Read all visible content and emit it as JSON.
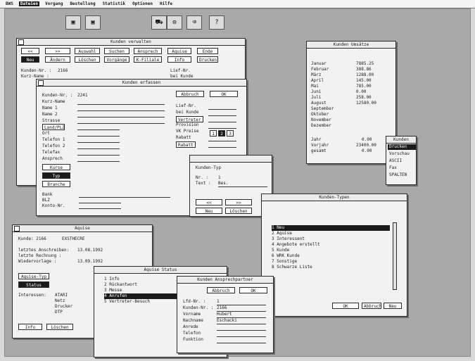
{
  "menubar": {
    "items": [
      "BWS",
      "Dateien",
      "Vorgang",
      "Bestellung",
      "Statistik",
      "Optionen",
      "Hilfe"
    ]
  },
  "win_verwalten": {
    "title": "Kunden verwalten",
    "buttons": [
      "<<",
      ">>",
      "Auswahl",
      "Suchen",
      "Ansprech",
      "Aquise",
      "Ende",
      "Neu",
      "Ändern",
      "Löschen",
      "Vorgänge",
      "K-Filiale",
      "Info",
      "Drucken"
    ],
    "kundennr_label": "Kunden-Nr. :",
    "kundennr_value": "2166",
    "kurzname_label": "Kurz-Name :",
    "liefnr_label": "Lief-Nr.",
    "ansprech_label": "bei Kunde"
  },
  "win_erfassen": {
    "title": "Kunden erfassen",
    "abbruch": "Abbruch",
    "ok": "OK",
    "fields": [
      "Kunden-Nr. :",
      "Kurz-Name",
      "Name 1",
      "Name 2",
      "Strasse",
      "Land/PLZ",
      "Ort",
      "Telefon 1",
      "Telefon 2",
      "Telefax",
      "Ansprech"
    ],
    "kundennr_value": "2241",
    "right_labels": [
      "Lief-Nr.",
      "bei Kunde",
      "Vertreter",
      "Provision",
      "VK Preise",
      "Rabatt",
      "Rabatt"
    ],
    "preise": [
      "1",
      "2",
      "3"
    ],
    "buttons": [
      "Kurse",
      "Typ",
      "Branche"
    ],
    "bottom": [
      "Bank",
      "BLZ",
      "Konto-Nr."
    ]
  },
  "win_umsatz": {
    "title": "Kunden Umsätze",
    "months": [
      "Januar",
      "Februar",
      "März",
      "April",
      "Mai",
      "Juni",
      "Juli",
      "August",
      "September",
      "Oktober",
      "November",
      "Dezember"
    ],
    "values": [
      "7885.25",
      "388.86",
      "1288.00",
      "145.00",
      "785.00",
      "0.00",
      "258.00",
      "12580.00",
      "",
      "",
      "",
      ""
    ],
    "jahr_label": "Jahr",
    "jahr_value": "0.00",
    "vorjahr_label": "Vorjahr",
    "vorjahr_value": "23400.00",
    "gesamt_label": "gesamt",
    "gesamt_value": "0.00"
  },
  "popup_menu": {
    "title": "Kunden",
    "items": [
      "Drucken",
      "Vorschau",
      "ASCII",
      "Fax",
      "SPALTEN"
    ],
    "selected": 0
  },
  "win_suche": {
    "title": "",
    "nr_label": "Kunden-Typ",
    "nr_key": "Nr. :",
    "nr_value": "1",
    "text_key": "Text :",
    "text_value": "Bes.",
    "buttons": [
      "<<",
      ">>",
      "Neu",
      "Löschen"
    ]
  },
  "win_typen": {
    "title": "Kunden-Typen",
    "items": [
      "1 Neu",
      "2 Aquise",
      "3 Interessent",
      "4 Angebote erstellt",
      "5 Kunde",
      "6 WRK Kunde",
      "7 Sonstige",
      "8 Schwarze Liste"
    ],
    "selected": 0,
    "buttons": [
      "OK",
      "Abbruch",
      "Neu"
    ]
  },
  "win_aquise": {
    "title": "Aquise",
    "kunde_label": "Kunde: 2166",
    "kunde_value": "EXSTHECRE",
    "letztes_label": "letztes Anschreiben:",
    "letztes_value": "13.08.1992",
    "rechnung_label": "letzte Rechnung :",
    "wieder_label": "Wiedervorlage :",
    "wieder_value": "13.09.1992",
    "aquise_typ_label": "Aquise-Typ",
    "status_label": "Status",
    "interessen_label": "Interessen:",
    "interessen_values": [
      "ATARI",
      "Netz",
      "Drucker",
      "DTP"
    ],
    "buttons": [
      "Info",
      "Löschen"
    ]
  },
  "win_status": {
    "title": "Aquise Status",
    "items": [
      "1 Info",
      "2 Rückantwort",
      "3 Messe",
      "4 Anrufen",
      "5 Vertreter-Besuch"
    ],
    "selected": 3
  },
  "win_ansprech": {
    "title": "Kunden Ansprechpartner",
    "abbruch": "Abbruch",
    "ok": "OK",
    "fields": [
      "Lfd-Nr. :",
      "Kunden-Nr. :",
      "Vorname",
      "Nachname",
      "Anrede",
      "Telefon",
      "Funktion"
    ],
    "values": [
      "1",
      "2166",
      "Hubert",
      "Eschacki",
      "",
      "",
      ""
    ]
  }
}
